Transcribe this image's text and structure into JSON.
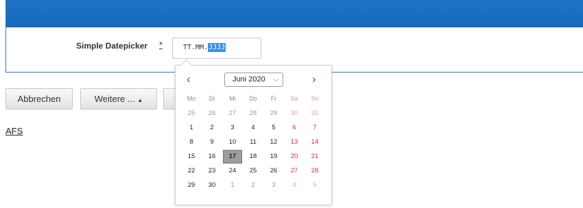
{
  "form": {
    "field_label": "Simple Datepicker",
    "required_marker": "*",
    "date_value_prefix": "TT.MM.",
    "date_value_selected": "JJJJ"
  },
  "buttons": {
    "cancel_label": "Abbrechen",
    "more_label": "Weitere ...",
    "more_arrow": "▲"
  },
  "link_label": "AFS",
  "datepicker": {
    "prev_label": "‹",
    "next_label": "›",
    "month_value": "Juni 2020",
    "weekdays": [
      "Mo",
      "Di",
      "Mi",
      "Do",
      "Fr",
      "Sa",
      "So"
    ],
    "today": "17",
    "weeks": [
      [
        "25",
        "26",
        "27",
        "28",
        "29",
        "30",
        "31"
      ],
      [
        "1",
        "2",
        "3",
        "4",
        "5",
        "6",
        "7"
      ],
      [
        "8",
        "9",
        "10",
        "11",
        "12",
        "13",
        "14"
      ],
      [
        "15",
        "16",
        "17",
        "18",
        "19",
        "20",
        "21"
      ],
      [
        "22",
        "23",
        "24",
        "25",
        "26",
        "27",
        "28"
      ],
      [
        "29",
        "30",
        "1",
        "2",
        "3",
        "4",
        "5"
      ]
    ]
  },
  "colors": {
    "header_blue": "#1f74c9",
    "weekend_red": "#d42c2c",
    "selection_blue": "#3b8fe8"
  }
}
